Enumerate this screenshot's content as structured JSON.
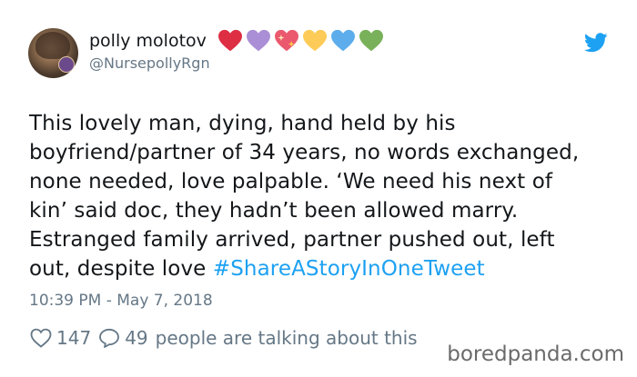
{
  "tweet": {
    "author": {
      "display_name": "polly molotov",
      "handle": "@NursepollyRgn",
      "name_emojis": [
        "red-heart",
        "purple-heart",
        "sparkling-heart",
        "yellow-heart",
        "blue-heart",
        "green-heart"
      ]
    },
    "text_lines": [
      "This lovely man, dying, hand held by his",
      "boyfriend/partner of 34 years, no words exchanged,",
      "none needed, love palpable. ‘We need his next of",
      "kin’ said doc, they hadn’t been allowed marry.",
      "Estranged family arrived, partner pushed out, left",
      "out, despite love "
    ],
    "hashtag": "#ShareAStoryInOneTweet",
    "timestamp": "10:39 PM - May 7, 2018",
    "likes": "147",
    "replies": "49",
    "talking_text": "people are talking about this"
  },
  "watermark": "boredpanda.com",
  "colors": {
    "link_blue": "#1da1f2",
    "secondary_text": "#657786",
    "primary_text": "#14171a"
  },
  "icons": [
    "twitter-bird-icon",
    "heart-outline-icon",
    "reply-bubble-icon"
  ]
}
